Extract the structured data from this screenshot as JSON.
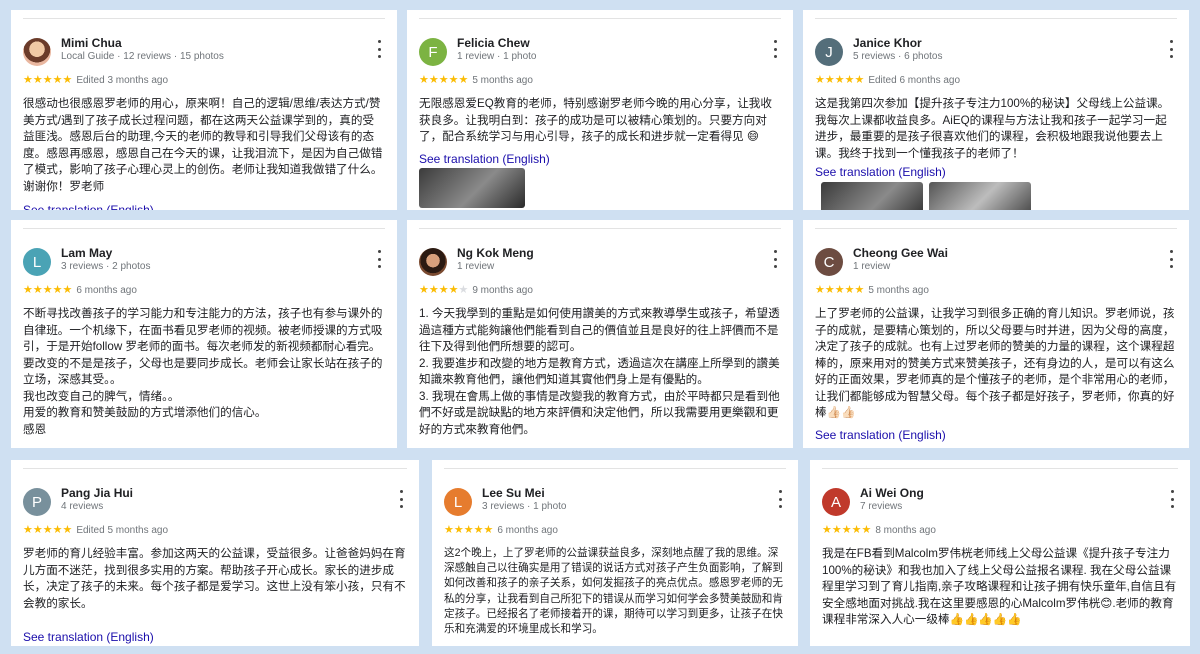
{
  "translate_label": "See translation (English)",
  "reviews": [
    {
      "name": "Mimi Chua",
      "meta": "Local Guide · 12 reviews · 15 photos",
      "stars": "★★★★★",
      "when": "Edited 3 months ago",
      "text": [
        "很感动也很感恩罗老师的用心，原来啊！自己的逻辑/思维/表达方式/赞美方式/遇到了孩子成长过程问题，都在这两天公益课学到的，真的受益匪浅。感恩后台的助理,今天的老师的教导和引导我们父母该有的态度。感恩再感恩，感恩自己在今天的课，让我泪流下，是因为自己做错了模式，影响了孩子心理心灵上的创伤。老师让我知道我做错了什么。谢谢你！罗老师"
      ],
      "avatar_color": "#c98a6a",
      "initial": ""
    },
    {
      "name": "Felicia Chew",
      "meta": "1 review · 1 photo",
      "stars": "★★★★★",
      "when": "5 months ago",
      "text": [
        "无限感恩爱EQ教育的老师，特别感谢罗老师今晚的用心分享，让我收获良多。让我明白到：孩子的成功是可以被精心策划的。只要方向对了，配合系统学习与用心引导，孩子的成长和进步就一定看得见 😄"
      ],
      "avatar_color": "#7cb342",
      "initial": "F"
    },
    {
      "name": "Janice Khor",
      "meta": "5 reviews · 6 photos",
      "stars": "★★★★★",
      "when": "Edited 6 months ago",
      "text": [
        "这是我第四次参加【提升孩子专注力100%的秘诀】父母线上公益课。我每次上课都收益良多。AiEQ的课程与方法让我和孩子一起学习一起进步，最重要的是孩子很喜欢他们的课程，会积极地跟我说他要去上课。我终于找到一个懂我孩子的老师了！"
      ],
      "avatar_color": "#546e7a",
      "initial": "J"
    },
    {
      "name": "Lam May",
      "meta": "3 reviews · 2 photos",
      "stars": "★★★★★",
      "when": "6 months ago",
      "text": [
        "不断寻找改善孩子的学习能力和专注能力的方法，孩子也有参与课外的自律班。一个机缘下，在面书看见罗老师的视频。被老师授课的方式吸引，于是开始follow 罗老师的面书。每次老师发的新视频都耐心看完。要改变的不是是孩子，父母也是要同步成长。老师会让家长站在孩子的立场，深感其受。。",
        "我也改变自己的脾气，情绪。。",
        "用爱的教育和赞美鼓励的方式增添他们的信心。",
        "感恩"
      ],
      "avatar_color": "#4aa3b5",
      "initial": "L"
    },
    {
      "name": "Ng Kok Meng",
      "meta": "1 review",
      "stars": "★★★★",
      "stars_off": "★",
      "when": "9 months ago",
      "text": [
        "1. 今天我學到的重點是如何使用讚美的方式來教導學生或孩子，希望透過這種方式能夠讓他們能看到自己的價值並且是良好的往上評價而不是往下及得到他們所想要的認可。",
        "2. 我要進步和改變的地方是教育方式，透過這次在講座上所學到的讚美知識來教育他們，讓他們知道其實他們身上是有優點的。",
        "3. 我現在會馬上做的事情是改變我的教育方式，由於平時都只是看到他們不好或是說缺點的地方來評價和決定他們，所以我需要用更樂觀和更好的方式來教育他們。"
      ],
      "avatar_color": "#8d4a2c",
      "initial": ""
    },
    {
      "name": "Cheong Gee Wai",
      "meta": "1 review",
      "stars": "★★★★★",
      "when": "5 months ago",
      "text": [
        "上了罗老师的公益课，让我学习到很多正确的育儿知识。罗老师说，孩子的成就，是要精心策划的，所以父母要与时并进，因为父母的高度，决定了孩子的成就。也有上过罗老师的赞美的力量的课程，这个课程超棒的，原来用对的赞美方式来赞美孩子，还有身边的人，是可以有这么好的正面效果，罗老师真的是个懂孩子的老师，是个非常用心的老师，让我们都能够成为智慧父母。每个孩子都是好孩子，罗老师，你真的好棒👍🏻👍🏻"
      ],
      "avatar_color": "#6d4c41",
      "initial": "C"
    },
    {
      "name": "Pang Jia Hui",
      "meta": "4 reviews",
      "stars": "★★★★★",
      "when": "Edited 5 months ago",
      "text": [
        "罗老师的育儿经验丰富。参加这两天的公益课，受益很多。让爸爸妈妈在育儿方面不迷茫，找到很多实用的方案。帮助孩子开心成长。家长的进步成长，决定了孩子的未来。每个孩子都是爱学习。这世上没有笨小孩，只有不会教的家长。"
      ],
      "avatar_color": "#78909c",
      "initial": "P"
    },
    {
      "name": "Lee Su Mei",
      "meta": "3 reviews · 1 photo",
      "stars": "★★★★★",
      "when": "6 months ago",
      "text": [
        "这2个晚上，上了罗老师的公益课获益良多，深刻地点醒了我的思维。深深感触自己以往确实是用了错误的说话方式对孩子产生负面影响，了解到如何改善和孩子的亲子关系，如何发掘孩子的亮点优点。感恩罗老师的无私的分享，让我看到自己所犯下的错误从而学习如何学会多赞美鼓励和肯定孩子。已经报名了老师接着开的课，期待可以学习到更多，让孩子在快乐和充满爱的环境里成长和学习。"
      ],
      "avatar_color": "#e67c2e",
      "initial": "L"
    },
    {
      "name": "Ai Wei Ong",
      "meta": "7 reviews",
      "stars": "★★★★★",
      "when": "8 months ago",
      "text": [
        "我是在FB看到Malcolm罗伟桄老师线上父母公益课《提升孩子专注力100%的秘诀》和我也加入了线上父母公益报名课程. 我在父母公益课程里学习到了育儿指南,亲子攻略课程和让孩子拥有快乐童年,自信且有安全感地面对挑战.我在这里要感恩的心Malcolm罗伟桄😊.老师的教育课程非常深入人心一级棒👍👍👍👍👍"
      ],
      "avatar_color": "#c0392b",
      "initial": "A"
    }
  ]
}
